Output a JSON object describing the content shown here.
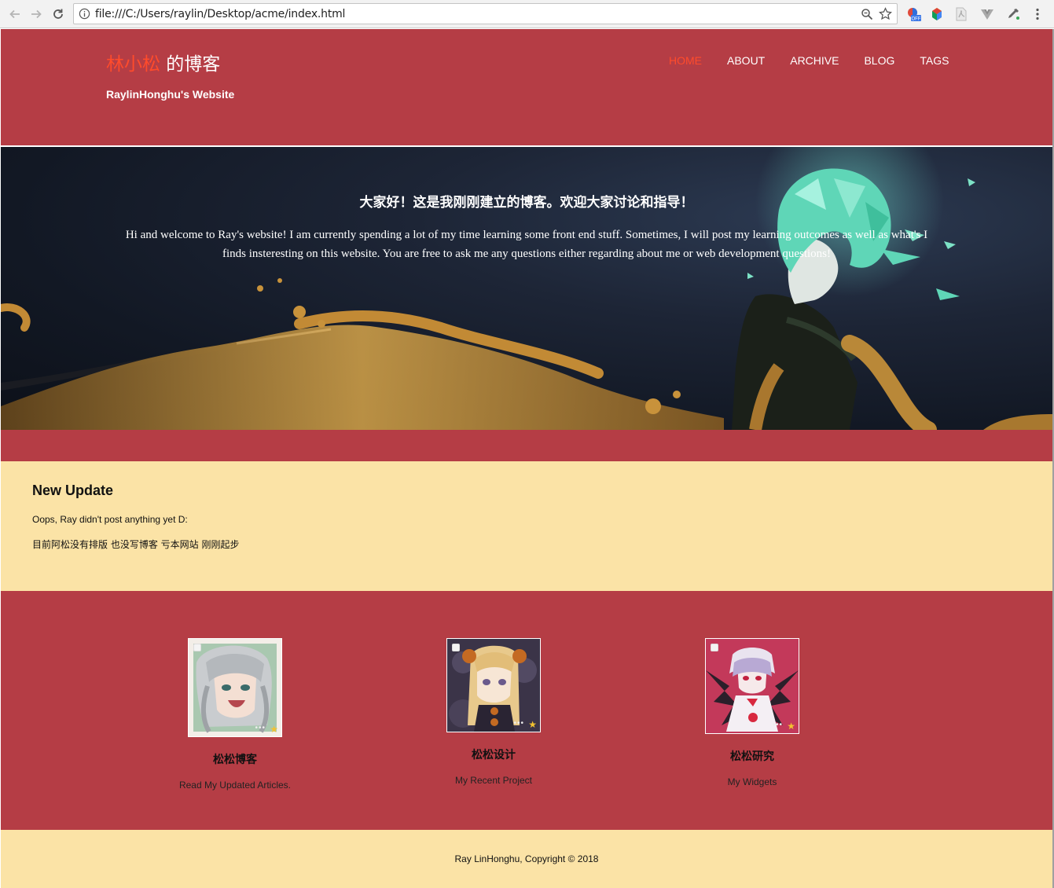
{
  "browser": {
    "url": "file:///C:/Users/raylin/Desktop/acme/index.html",
    "icons": [
      "back-arrow-icon",
      "forward-arrow-icon",
      "reload-icon",
      "info-icon",
      "zoom-icon",
      "bookmark-star-icon",
      "menu-dots-icon"
    ],
    "extension_badge": "OFF"
  },
  "header": {
    "title_highlight": "林小松",
    "title_rest": " 的博客",
    "subtitle": "RaylinHonghu's Website",
    "nav": [
      {
        "label": "HOME",
        "active": true
      },
      {
        "label": "ABOUT",
        "active": false
      },
      {
        "label": "ARCHIVE",
        "active": false
      },
      {
        "label": "BLOG",
        "active": false
      },
      {
        "label": "TAGS",
        "active": false
      }
    ]
  },
  "hero": {
    "title": "大家好！这是我刚刚建立的博客。欢迎大家讨论和指导！",
    "body": "Hi and welcome to Ray's website! I am currently spending a lot of my time learning some front end stuff. Sometimes, I will post my learning outcomes as well as what's I finds insteresting on this website. You are free to ask me any questions either regarding about me or web development questions!"
  },
  "update": {
    "heading": "New Update",
    "line1": "Oops, Ray didn't post anything yet D:",
    "line2": "目前阿松没有排版 也没写博客 亏本网站 刚刚起步"
  },
  "cards": [
    {
      "title": "松松博客",
      "caption": "Read My Updated Articles."
    },
    {
      "title": "松松设计",
      "caption": "My Recent Project"
    },
    {
      "title": "松松研究",
      "caption": "My Widgets"
    }
  ],
  "footer": {
    "text": "Ray LinHonghu, Copyright © 2018"
  },
  "colors": {
    "header_red": "#b53d45",
    "accent": "#ff4b2b",
    "cream": "#fbe3a6"
  }
}
